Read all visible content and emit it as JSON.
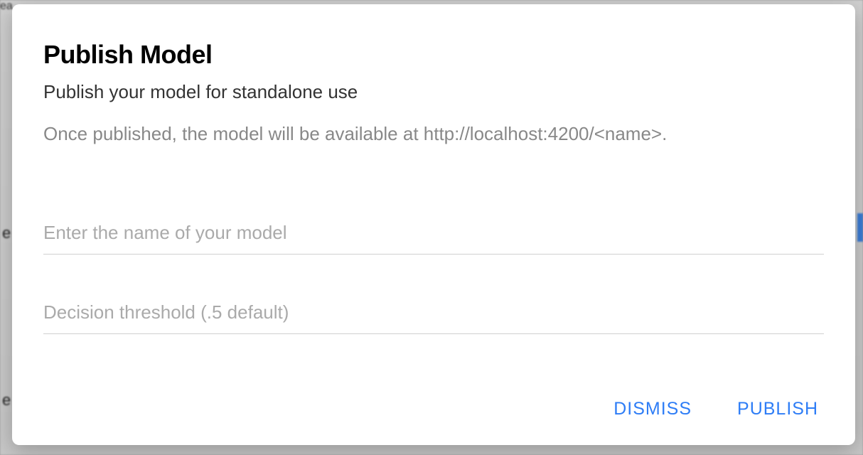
{
  "modal": {
    "title": "Publish Model",
    "subtitle": "Publish your model for standalone use",
    "description": "Once published, the model will be available at http://localhost:4200/<name>.",
    "nameInput": {
      "placeholder": "Enter the name of your model",
      "value": ""
    },
    "thresholdInput": {
      "placeholder": "Decision threshold (.5 default)",
      "value": ""
    },
    "actions": {
      "dismiss": "DISMISS",
      "publish": "PUBLISH"
    }
  },
  "backdrop": {
    "text1": "ea",
    "text2": "e",
    "text3": "e"
  }
}
